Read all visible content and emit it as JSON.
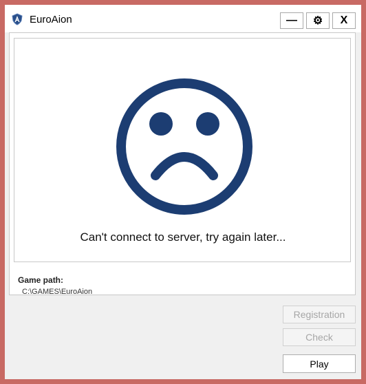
{
  "window": {
    "title": "EuroAion",
    "icon": "shield-logo-icon",
    "controls": {
      "minimize_label": "—",
      "settings_icon": "gear-icon",
      "settings_glyph": "⚙",
      "close_label": "X"
    }
  },
  "status": {
    "icon": "sad-face-icon",
    "message": "Can't connect to server, try again later..."
  },
  "game_path": {
    "label": "Game path:",
    "value": "C:\\GAMES\\EuroAion"
  },
  "actions": {
    "registration_label": "Registration",
    "check_label": "Check",
    "play_label": "Play"
  },
  "colors": {
    "face": "#1c3d72",
    "frame": "#c86a64",
    "disabled_text": "#a6a6a6"
  }
}
